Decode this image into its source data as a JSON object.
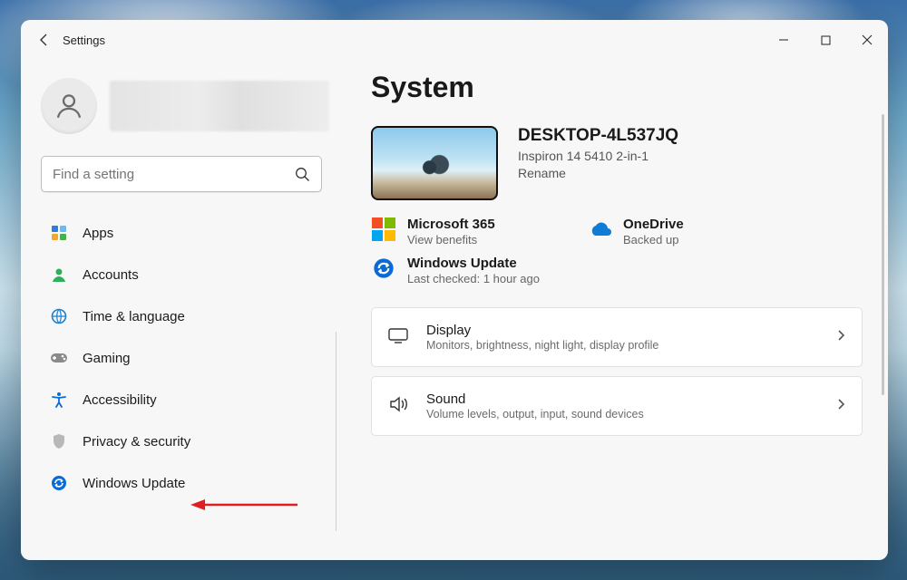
{
  "window": {
    "title": "Settings"
  },
  "search": {
    "placeholder": "Find a setting"
  },
  "nav": {
    "items": [
      {
        "label": "Apps"
      },
      {
        "label": "Accounts"
      },
      {
        "label": "Time & language"
      },
      {
        "label": "Gaming"
      },
      {
        "label": "Accessibility"
      },
      {
        "label": "Privacy & security"
      },
      {
        "label": "Windows Update"
      }
    ]
  },
  "page": {
    "heading": "System",
    "device": {
      "name": "DESKTOP-4L537JQ",
      "model": "Inspiron 14 5410 2-in-1",
      "rename": "Rename"
    },
    "status": {
      "m365": {
        "label": "Microsoft 365",
        "sub": "View benefits"
      },
      "onedrive": {
        "label": "OneDrive",
        "sub": "Backed up"
      },
      "winupdate": {
        "label": "Windows Update",
        "sub": "Last checked: 1 hour ago"
      }
    },
    "cards": {
      "display": {
        "label": "Display",
        "sub": "Monitors, brightness, night light, display profile"
      },
      "sound": {
        "label": "Sound",
        "sub": "Volume levels, output, input, sound devices"
      }
    }
  }
}
